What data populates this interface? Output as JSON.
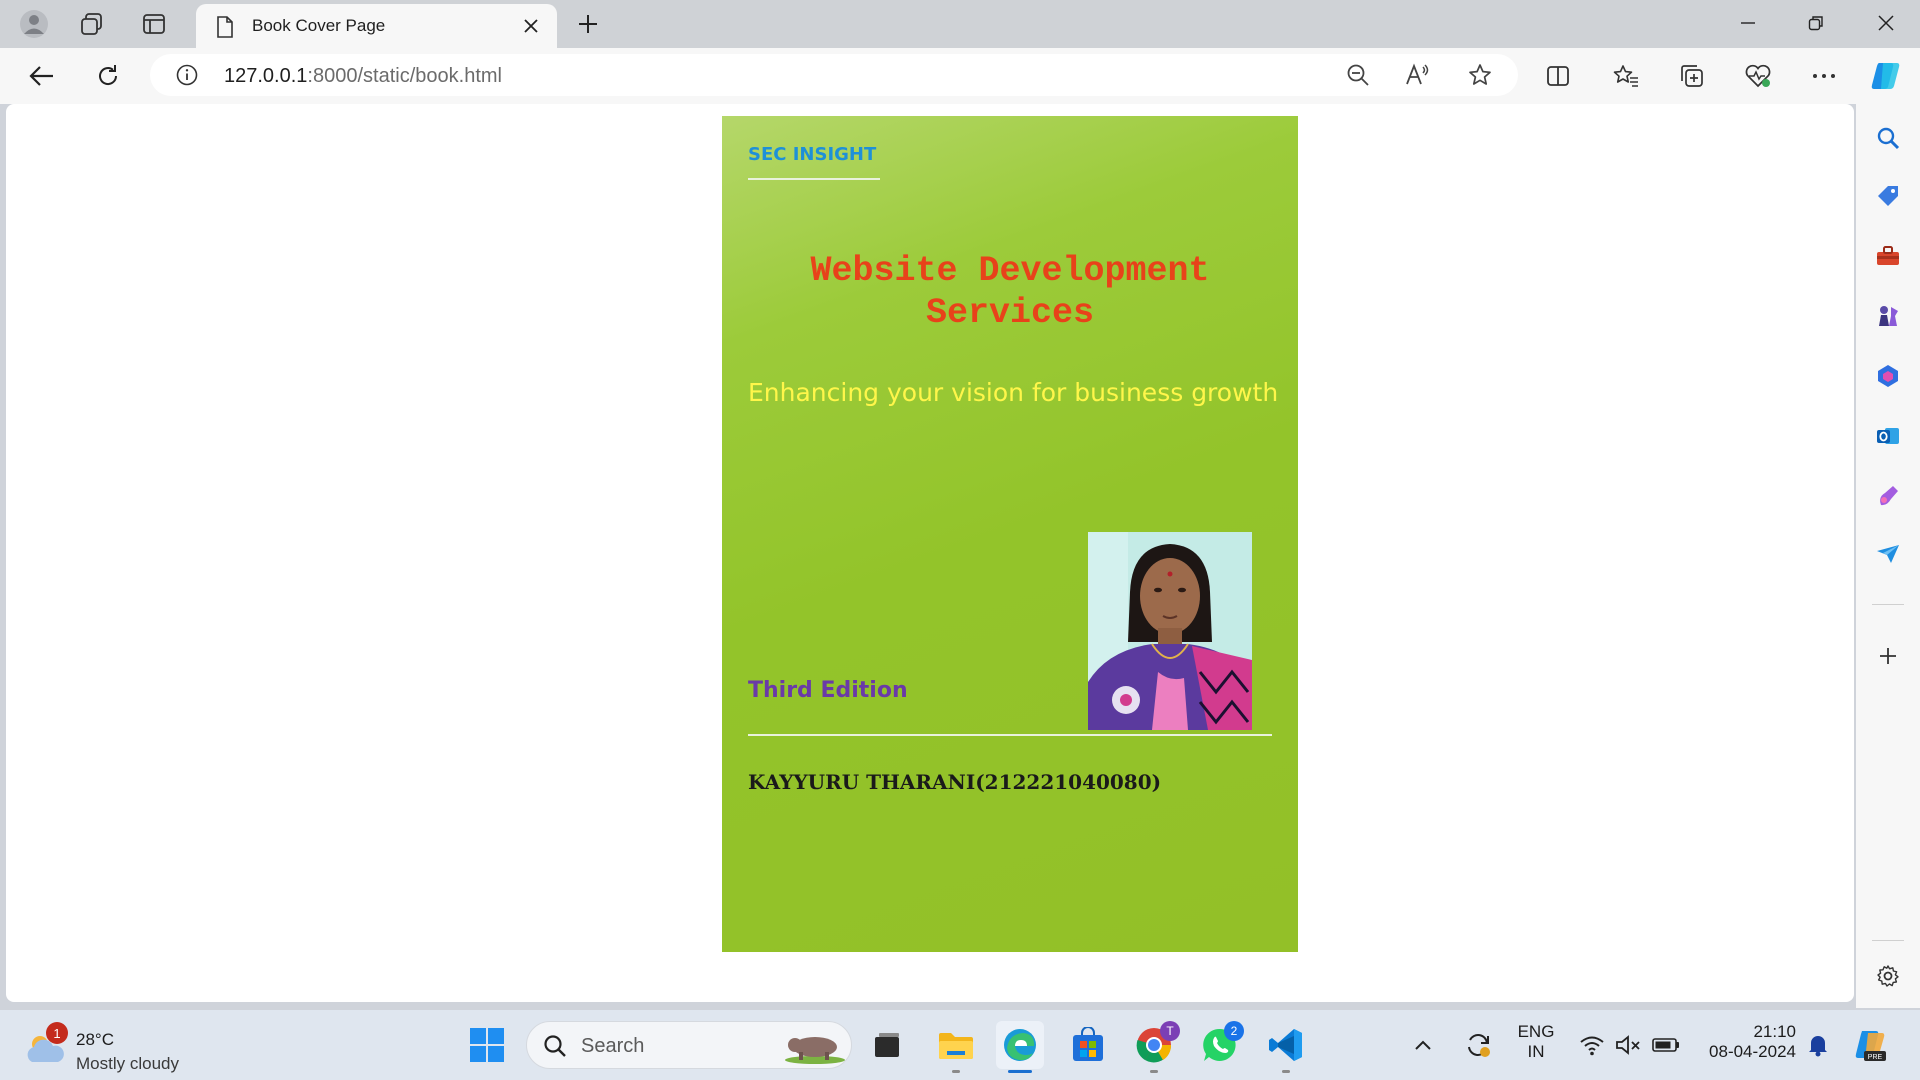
{
  "browser": {
    "tab": {
      "title": "Book Cover Page"
    },
    "address": {
      "host": "127.0.0.1",
      "path": ":8000/static/book.html"
    }
  },
  "cover": {
    "brand": "SEC INSIGHT",
    "title_line1": "Website Development",
    "title_line2": "Services",
    "tagline": "Enhancing your vision for business growth",
    "edition": "Third Edition",
    "author": "KAYYURU THARANI(212221040080)",
    "colors": {
      "background": "#93c42a",
      "title": "#e8421a",
      "tagline": "#fff64a",
      "brand": "#1e90d8",
      "edition": "#6a3aa8"
    }
  },
  "taskbar": {
    "weather": {
      "temp": "28°C",
      "desc": "Mostly cloudy",
      "badge": "1"
    },
    "search_label": "Search",
    "apps": [
      "start-icon",
      "search-icon",
      "task-view-icon",
      "file-explorer-icon",
      "edge-icon",
      "store-icon",
      "chrome-icon",
      "whatsapp-icon",
      "vscode-icon"
    ],
    "chrome_badge": "T",
    "whatsapp_badge": "2",
    "lang_line1": "ENG",
    "lang_line2": "IN",
    "time": "21:10",
    "date": "08-04-2024"
  }
}
